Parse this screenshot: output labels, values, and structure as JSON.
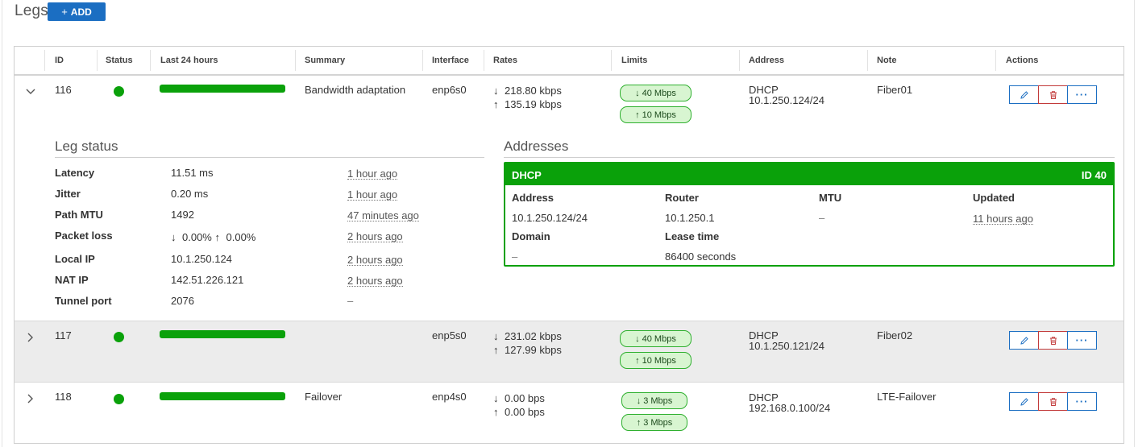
{
  "header": {
    "title": "Legs",
    "add_label": "ADD",
    "add_icon": "+"
  },
  "table": {
    "columns": [
      "ID",
      "Status",
      "Last 24 hours",
      "Summary",
      "Interface",
      "Rates",
      "Limits",
      "Address",
      "Note",
      "Actions"
    ],
    "rows": [
      {
        "id": "116",
        "expanded": true,
        "status_color": "#0aa10a",
        "uptime_24h": 1.0,
        "summary": "Bandwidth adaptation",
        "interface": "enp6s0",
        "rate_down": "218.80 kbps",
        "rate_up": "135.19 kbps",
        "limit_down": "40 Mbps",
        "limit_up": "10 Mbps",
        "address_type": "DHCP",
        "address": "10.1.250.124/24",
        "note": "Fiber01"
      },
      {
        "id": "117",
        "expanded": false,
        "status_color": "#0aa10a",
        "uptime_24h": 1.0,
        "summary": "",
        "interface": "enp5s0",
        "rate_down": "231.02 kbps",
        "rate_up": "127.99 kbps",
        "limit_down": "40 Mbps",
        "limit_up": "10 Mbps",
        "address_type": "DHCP",
        "address": "10.1.250.121/24",
        "note": "Fiber02"
      },
      {
        "id": "118",
        "expanded": false,
        "status_color": "#0aa10a",
        "uptime_24h": 1.0,
        "summary": "Failover",
        "interface": "enp4s0",
        "rate_down": "0.00 bps",
        "rate_up": "0.00 bps",
        "limit_down": "3 Mbps",
        "limit_up": "3 Mbps",
        "address_type": "DHCP",
        "address": "192.168.0.100/24",
        "note": "LTE-Failover"
      }
    ]
  },
  "leg_status": {
    "title": "Leg status",
    "items": [
      {
        "label": "Latency",
        "value": "11.51 ms",
        "time": "1 hour ago"
      },
      {
        "label": "Jitter",
        "value": "0.20 ms",
        "time": "1 hour ago"
      },
      {
        "label": "Path MTU",
        "value": "1492",
        "time": "47 minutes ago"
      },
      {
        "label": "Packet loss",
        "value_down": "0.00%",
        "value_up": "0.00%",
        "time": "2 hours ago"
      },
      {
        "label": "Local IP",
        "value": "10.1.250.124",
        "time": "2 hours ago"
      },
      {
        "label": "NAT IP",
        "value": "142.51.226.121",
        "time": "2 hours ago"
      },
      {
        "label": "Tunnel port",
        "value": "2076",
        "time": "–"
      }
    ]
  },
  "addresses": {
    "title": "Addresses",
    "card": {
      "type": "DHCP",
      "id_label": "ID 40",
      "address_label": "Address",
      "address": "10.1.250.124/24",
      "router_label": "Router",
      "router": "10.1.250.1",
      "mtu_label": "MTU",
      "mtu": "–",
      "updated_label": "Updated",
      "updated": "11 hours ago",
      "domain_label": "Domain",
      "domain": "–",
      "lease_label": "Lease time",
      "lease": "86400 seconds"
    }
  },
  "icons": {
    "down_arrow": "↓",
    "up_arrow": "↑",
    "more": "···",
    "edit": "pencil-icon",
    "delete": "trash-icon",
    "expand": "chevron-right-icon",
    "collapse": "chevron-down-icon"
  },
  "colors": {
    "accent": "#1b6ec2",
    "status_ok": "#0aa10a",
    "danger": "#c23a3a",
    "pill_bg": "#d8f5d1"
  }
}
